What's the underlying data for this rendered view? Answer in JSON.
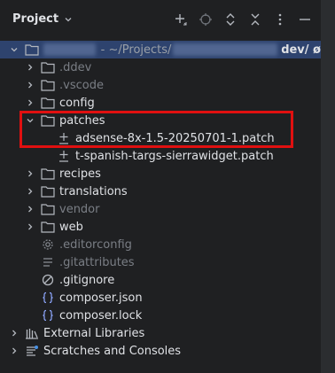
{
  "header": {
    "title": "Project",
    "toolbar_icons": [
      "add-icon",
      "locate-icon",
      "expand-all-icon",
      "collapse-all-icon",
      "more-icon",
      "minimize-icon"
    ]
  },
  "tree": {
    "root": {
      "path_prefix": "- ~/Projects/",
      "path_suffix": "dev/ ø"
    },
    "items": [
      {
        "label": ".ddev",
        "type": "folder",
        "muted": true
      },
      {
        "label": ".vscode",
        "type": "folder",
        "muted": true
      },
      {
        "label": "config",
        "type": "folder",
        "muted": false
      },
      {
        "label": "patches",
        "type": "folder",
        "muted": false,
        "expanded": true
      },
      {
        "label": "adsense-8x-1.5-20250701-1.patch",
        "type": "patch",
        "muted": false
      },
      {
        "label": "t-spanish-targs-sierrawidget.patch",
        "type": "patch",
        "muted": false
      },
      {
        "label": "recipes",
        "type": "folder",
        "muted": false
      },
      {
        "label": "translations",
        "type": "folder",
        "muted": false
      },
      {
        "label": "vendor",
        "type": "folder",
        "muted": true
      },
      {
        "label": "web",
        "type": "folder",
        "muted": false
      },
      {
        "label": ".editorconfig",
        "type": "gear",
        "muted": true
      },
      {
        "label": ".gitattributes",
        "type": "lines",
        "muted": true
      },
      {
        "label": ".gitignore",
        "type": "ignore",
        "muted": false
      },
      {
        "label": "composer.json",
        "type": "json",
        "muted": false
      },
      {
        "label": "composer.lock",
        "type": "json",
        "muted": false
      }
    ],
    "external_libraries": "External Libraries",
    "scratches": "Scratches and Consoles"
  },
  "colors": {
    "selection": "#2e436e",
    "highlight_box": "#e01010",
    "folder_icon": "#b4b8bf"
  }
}
